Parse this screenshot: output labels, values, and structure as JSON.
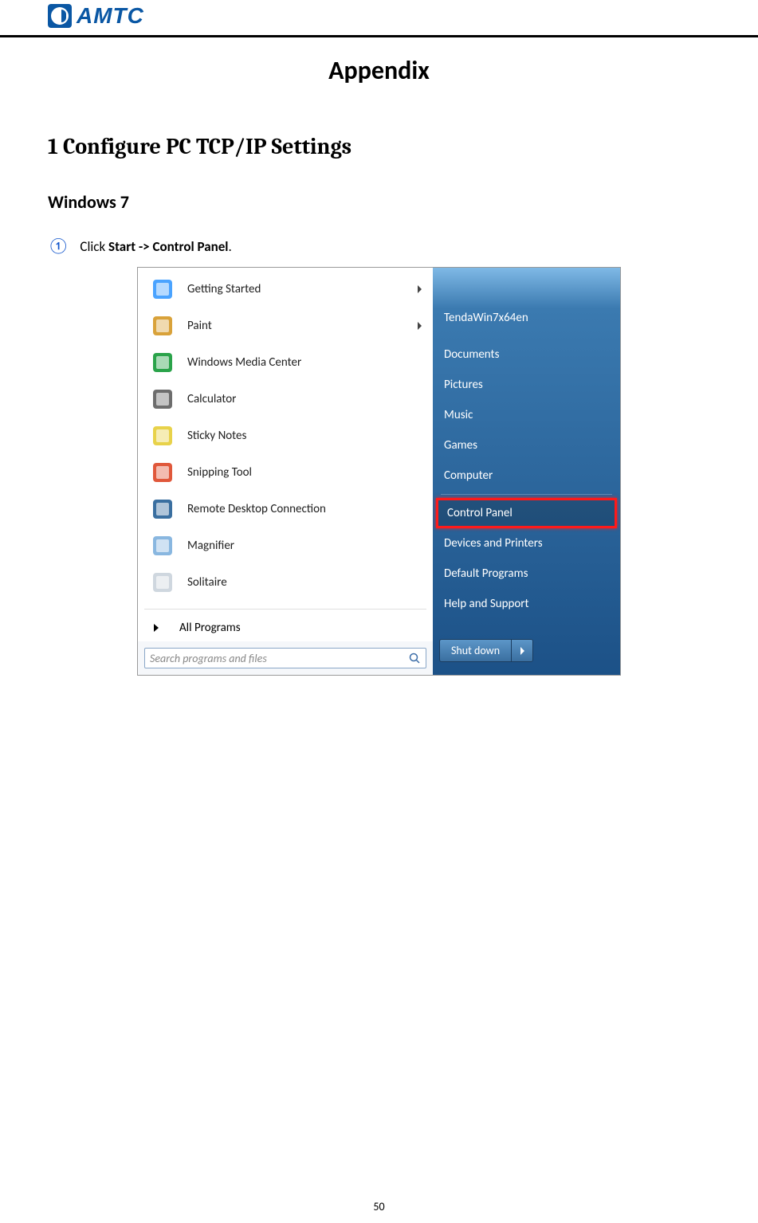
{
  "doc": {
    "brand": "AMTC",
    "title": "Appendix",
    "section1": "1 Configure PC TCP/IP Settings",
    "section2": "Windows 7",
    "step_number": "①",
    "step_prefix": "Click ",
    "step_bold": "Start -> Control Panel",
    "step_suffix": ".",
    "page_number": "50"
  },
  "start_menu": {
    "programs": [
      {
        "label": "Getting Started",
        "icon": "#4aa3ff",
        "submenu": true
      },
      {
        "label": "Paint",
        "icon": "#d9a23a",
        "submenu": true
      },
      {
        "label": "Windows Media Center",
        "icon": "#2aa34a",
        "submenu": false
      },
      {
        "label": "Calculator",
        "icon": "#6d6d6d",
        "submenu": false
      },
      {
        "label": "Sticky Notes",
        "icon": "#e8d24a",
        "submenu": false
      },
      {
        "label": "Snipping Tool",
        "icon": "#e0583b",
        "submenu": false
      },
      {
        "label": "Remote Desktop Connection",
        "icon": "#3a6fa0",
        "submenu": false
      },
      {
        "label": "Magnifier",
        "icon": "#89b7e0",
        "submenu": false
      },
      {
        "label": "Solitaire",
        "icon": "#cfd7df",
        "submenu": false
      }
    ],
    "all_programs": "All Programs",
    "search_placeholder": "Search programs and files",
    "right_items": [
      {
        "label": "TendaWin7x64en",
        "highlight": false,
        "space_after": true
      },
      {
        "label": "Documents",
        "highlight": false
      },
      {
        "label": "Pictures",
        "highlight": false
      },
      {
        "label": "Music",
        "highlight": false
      },
      {
        "label": "Games",
        "highlight": false
      },
      {
        "label": "Computer",
        "highlight": false,
        "divider_after": true
      },
      {
        "label": "Control Panel",
        "highlight": true
      },
      {
        "label": "Devices and Printers",
        "highlight": false
      },
      {
        "label": "Default Programs",
        "highlight": false
      },
      {
        "label": "Help and Support",
        "highlight": false
      }
    ],
    "shutdown_label": "Shut down"
  }
}
